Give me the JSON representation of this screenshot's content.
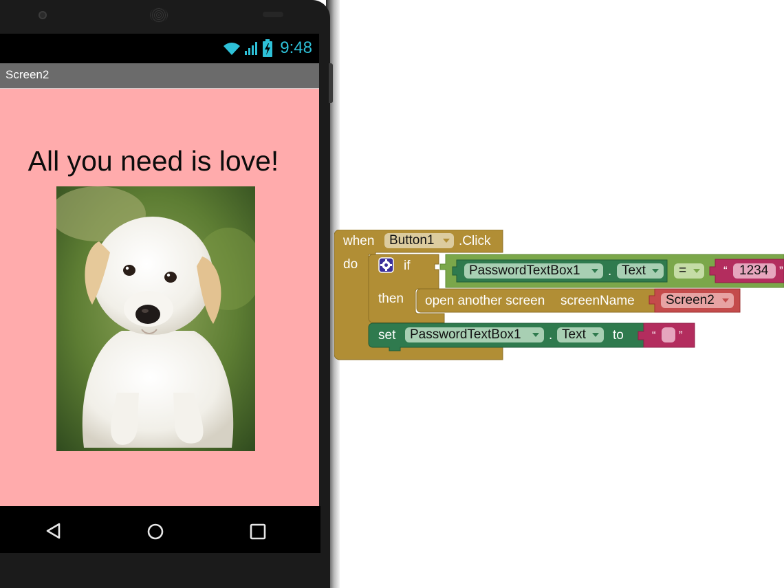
{
  "phone": {
    "status_time": "9:48",
    "screen_title": "Screen2",
    "headline": "All you need is love!",
    "image_subject": "white puppy photo",
    "nav_buttons": [
      "back",
      "home",
      "recent-apps"
    ],
    "colors": {
      "background": "#ffabac",
      "title_bar": "#6b6b6b",
      "status_accent": "#2ec1d8"
    }
  },
  "blocks": {
    "event": {
      "when": "when",
      "component": "Button1",
      "event": ".Click",
      "do": "do"
    },
    "if_block": {
      "if": "if",
      "then": "then",
      "condition": {
        "left_component": "PasswordTextBox1",
        "left_dot": ".",
        "left_property": "Text",
        "operator": "=",
        "right_value": "1234"
      }
    },
    "open_screen": {
      "label": "open another screen",
      "param": "screenName",
      "value": "Screen2"
    },
    "set_block": {
      "set": "set",
      "component": "PasswordTextBox1",
      "dot": ".",
      "property": "Text",
      "to": "to",
      "value": ""
    },
    "colors": {
      "event": "#b18e35",
      "control": "#b18e35",
      "logic": "#7ba74a",
      "component": "#2f7a4e",
      "text_string": "#b32d5e",
      "screen": "#c44b4b"
    }
  }
}
